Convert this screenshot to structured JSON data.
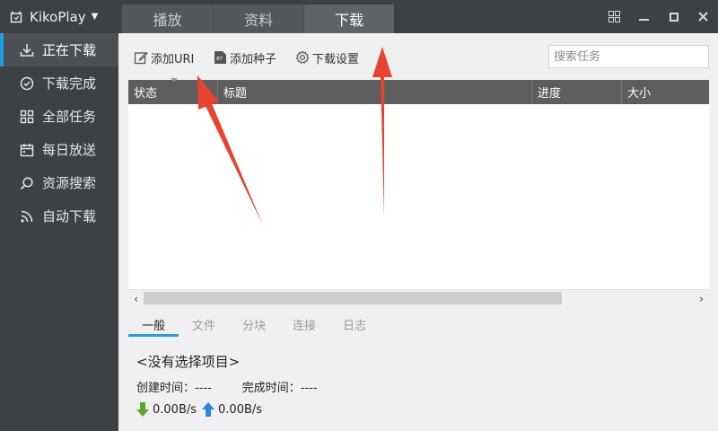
{
  "app": {
    "name": "KikoPlay"
  },
  "tabs": [
    {
      "label": "播放",
      "active": false
    },
    {
      "label": "资料",
      "active": false
    },
    {
      "label": "下载",
      "active": true
    }
  ],
  "sidebar": {
    "items": [
      {
        "label": "正在下载",
        "icon": "download-icon",
        "active": true
      },
      {
        "label": "下载完成",
        "icon": "check-circle-icon",
        "active": false
      },
      {
        "label": "全部任务",
        "icon": "grid-icon",
        "active": false
      },
      {
        "label": "每日放送",
        "icon": "calendar-icon",
        "active": false
      },
      {
        "label": "资源搜索",
        "icon": "search-icon",
        "active": false
      },
      {
        "label": "自动下载",
        "icon": "rss-icon",
        "active": false
      }
    ]
  },
  "toolbar": {
    "add_uri": "添加URI",
    "add_torrent": "添加种子",
    "settings": "下载设置",
    "search_placeholder": "搜索任务"
  },
  "table": {
    "columns": [
      "状态",
      "标题",
      "进度",
      "大小"
    ],
    "rows": []
  },
  "detail_tabs": [
    {
      "label": "一般",
      "active": true
    },
    {
      "label": "文件",
      "active": false
    },
    {
      "label": "分块",
      "active": false
    },
    {
      "label": "连接",
      "active": false
    },
    {
      "label": "日志",
      "active": false
    }
  ],
  "detail": {
    "no_selection": "<没有选择项目>",
    "created_label": "创建时间：",
    "created_value": "----",
    "finished_label": "完成时间：",
    "finished_value": "----",
    "download_speed": "0.00B/s",
    "upload_speed": "0.00B/s"
  },
  "colors": {
    "accent": "#1e9ee6",
    "sidebar_bg": "#3c4146",
    "annotation_arrow": "#e8432e",
    "download_arrow": "#5aa92b",
    "upload_arrow": "#2d87e0"
  }
}
